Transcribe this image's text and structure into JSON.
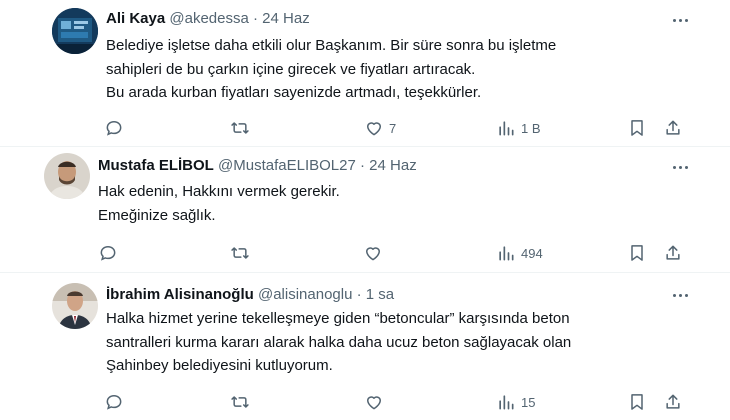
{
  "tweets": [
    {
      "name": "Ali Kaya",
      "handle": "@akedessa",
      "sep": "·",
      "time": "24 Haz",
      "lines": [
        "Belediye işletse daha etkili olur Başkanım.  Bir süre sonra bu işletme",
        "sahipleri de bu çarkın içine girecek ve fiyatları artıracak.",
        "Bu arada kurban fiyatları sayenizde artmadı, teşekkürler."
      ],
      "likes": "7",
      "views": "1 B"
    },
    {
      "name": "Mustafa ELİBOL",
      "handle": "@MustafaELIBOL27",
      "sep": "·",
      "time": "24 Haz",
      "lines": [
        "Hak edenin, Hakkını vermek gerekir.",
        "Emeğinize sağlık."
      ],
      "likes": "",
      "views": "494"
    },
    {
      "name": "İbrahim Alisinanoğlu",
      "handle": "@alisinanoglu",
      "sep": "·",
      "time": "1 sa",
      "lines": [
        "Halka hizmet yerine tekelleşmeye giden “betoncular” karşısında beton",
        "santralleri  kurma kararı alarak  halka daha ucuz beton sağlayacak olan",
        "Şahinbey belediyesini kutluyorum."
      ],
      "likes": "",
      "views": "15"
    }
  ],
  "icons": {
    "reply": "reply-icon",
    "retweet": "retweet-icon",
    "like": "heart-icon",
    "views": "views-icon",
    "bookmark": "bookmark-icon",
    "share": "share-icon",
    "more": "more-icon"
  },
  "colors": {
    "text": "#0f1419",
    "secondary": "#536471",
    "divider": "#eff3f4"
  }
}
